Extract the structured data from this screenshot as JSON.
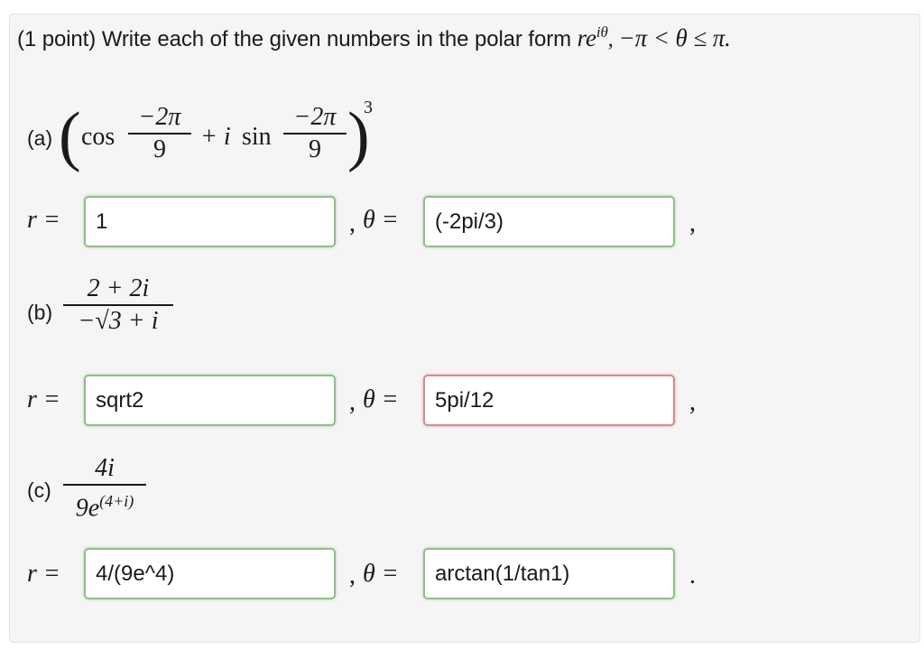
{
  "header": {
    "points": "(1 point)",
    "instruction": "Write each of the given numbers in the polar form",
    "form": "re",
    "form_exp": "iθ",
    "constraint": "−π < θ ≤ π."
  },
  "parts": [
    {
      "label": "(a)",
      "cos_word": "cos",
      "sin_word": "sin",
      "plus_i": "+ i",
      "angle_num": "−2π",
      "angle_den": "9",
      "power": "3",
      "r_label": "r =",
      "theta_label": "θ =",
      "r_value": "1",
      "theta_value": "(-2pi/3)",
      "theta_status": "correct",
      "trailing": ","
    },
    {
      "label": "(b)",
      "numerator": "2 + 2i",
      "denominator": "−√3 + i",
      "r_label": "r =",
      "theta_label": "θ =",
      "r_value": "sqrt2",
      "theta_value": "5pi/12",
      "theta_status": "incorrect",
      "trailing": ","
    },
    {
      "label": "(c)",
      "numerator": "4i",
      "denominator_base": "9e",
      "denominator_exp": "(4+i)",
      "r_label": "r =",
      "theta_label": "θ =",
      "r_value": "4/(9e^4)",
      "theta_value": "arctan(1/tan1)",
      "theta_status": "correct",
      "trailing": "."
    }
  ],
  "colors": {
    "correct_border": "#8fbf87",
    "incorrect_border": "#d88a8a",
    "panel_bg": "#f5f5f5"
  }
}
